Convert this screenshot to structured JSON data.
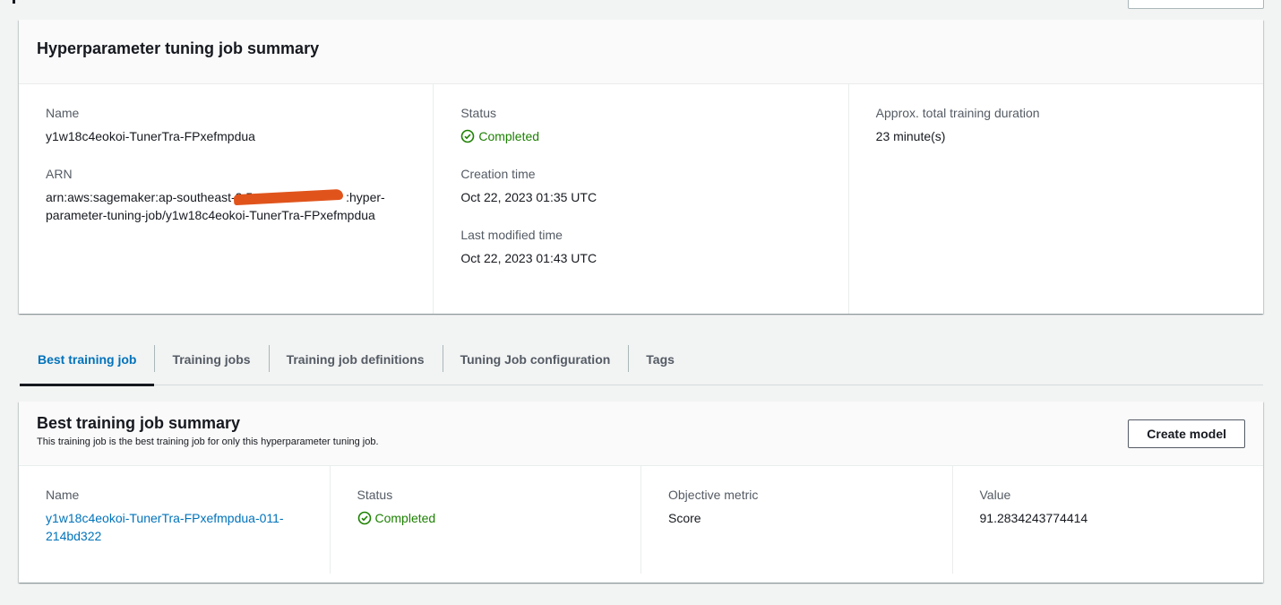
{
  "summary": {
    "title": "Hyperparameter tuning job summary",
    "name_label": "Name",
    "name_value": "y1w18c4eokoi-TunerTra-FPxefmpdua",
    "arn_label": "ARN",
    "arn_line1": "arn:aws:sagemaker:ap-southeast-2:5",
    "arn_line1_tail": ":hyper-",
    "arn_line2": "parameter-tuning-job/y1w18c4eokoi-TunerTra-FPxefmpdua",
    "status_label": "Status",
    "status_value": "Completed",
    "creation_label": "Creation time",
    "creation_value": "Oct 22, 2023 01:35 UTC",
    "modified_label": "Last modified time",
    "modified_value": "Oct 22, 2023 01:43 UTC",
    "duration_label": "Approx. total training duration",
    "duration_value": "23 minute(s)"
  },
  "tabs": [
    {
      "label": "Best training job",
      "active": true
    },
    {
      "label": "Training jobs",
      "active": false
    },
    {
      "label": "Training job definitions",
      "active": false
    },
    {
      "label": "Tuning Job configuration",
      "active": false
    },
    {
      "label": "Tags",
      "active": false
    }
  ],
  "best": {
    "title": "Best training job summary",
    "subtitle": "This training job is the best training job for only this hyperparameter tuning job.",
    "create_model_label": "Create model",
    "name_label": "Name",
    "name_line1": "y1w18c4eokoi-TunerTra-FPxefmpdua-011-",
    "name_line2": "214bd322",
    "status_label": "Status",
    "status_value": "Completed",
    "metric_label": "Objective metric",
    "metric_value": "Score",
    "value_label": "Value",
    "value_value": "91.2834243774414"
  },
  "colors": {
    "success": "#1d8102",
    "link": "#0073bb",
    "redaction": "#e0541c"
  }
}
